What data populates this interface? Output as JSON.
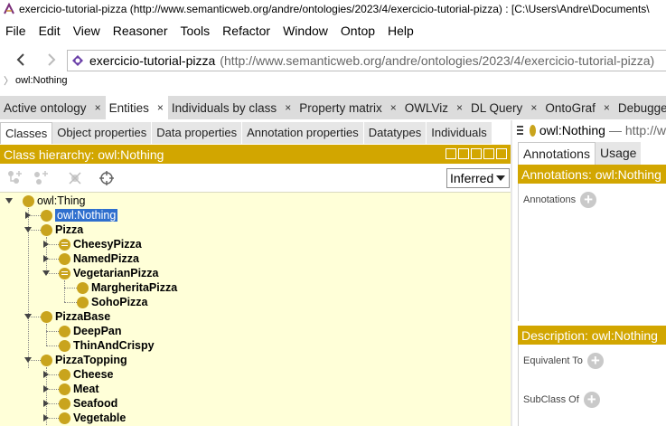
{
  "window": {
    "title": "exercicio-tutorial-pizza (http://www.semanticweb.org/andre/ontologies/2023/4/exercicio-tutorial-pizza) : [C:\\Users\\Andre\\Documents\\"
  },
  "menu": [
    "File",
    "Edit",
    "View",
    "Reasoner",
    "Tools",
    "Refactor",
    "Window",
    "Ontop",
    "Help"
  ],
  "address": {
    "ontology_name": "exercicio-tutorial-pizza",
    "ontology_iri": "(http://www.semanticweb.org/andre/ontologies/2023/4/exercicio-tutorial-pizza)"
  },
  "breadcrumb": "owl:Nothing",
  "tabs": [
    {
      "label": "Active ontology",
      "close": "×"
    },
    {
      "label": "Entities",
      "close": "×"
    },
    {
      "label": "Individuals by class",
      "close": "×"
    },
    {
      "label": "Property matrix",
      "close": "×"
    },
    {
      "label": "OWLViz",
      "close": "×"
    },
    {
      "label": "DL Query",
      "close": "×"
    },
    {
      "label": "OntoGraf",
      "close": "×"
    },
    {
      "label": "Debugger",
      "close": ""
    }
  ],
  "subtabs": [
    "Classes",
    "Object properties",
    "Data properties",
    "Annotation properties",
    "Datatypes",
    "Individuals"
  ],
  "hierarchy": {
    "header": "Class hierarchy: owl:Nothing",
    "mode_select": "Inferred"
  },
  "tree": [
    {
      "label": "owl:Thing",
      "plain": true
    },
    {
      "label": "owl:Nothing",
      "plain": true,
      "selected": true
    },
    {
      "label": "Pizza"
    },
    {
      "label": "CheesyPizza"
    },
    {
      "label": "NamedPizza"
    },
    {
      "label": "VegetarianPizza"
    },
    {
      "label": "MargheritaPizza"
    },
    {
      "label": "SohoPizza"
    },
    {
      "label": "PizzaBase"
    },
    {
      "label": "DeepPan"
    },
    {
      "label": "ThinAndCrispy"
    },
    {
      "label": "PizzaTopping"
    },
    {
      "label": "Cheese"
    },
    {
      "label": "Meat"
    },
    {
      "label": "Seafood"
    },
    {
      "label": "Vegetable"
    }
  ],
  "right": {
    "entity": "owl:Nothing",
    "entity_iri": "— http://w",
    "tabs": [
      "Annotations",
      "Usage"
    ],
    "annotations_header": "Annotations: owl:Nothing",
    "annotations_label": "Annotations",
    "description_header": "Description: owl:Nothing",
    "equivalent_label": "Equivalent To",
    "subclass_label": "SubClass Of"
  },
  "colors": {
    "accent": "#d2a600",
    "class_ball": "#c9a41d",
    "tree_bg": "#ffffd8",
    "selection": "#2f6fce"
  }
}
